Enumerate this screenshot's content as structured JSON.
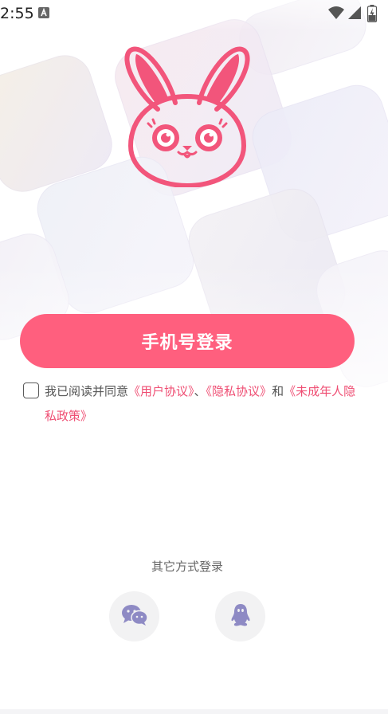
{
  "status_bar": {
    "time": "2:55"
  },
  "login": {
    "phone_button_label": "手机号登录"
  },
  "agreement": {
    "prefix": "我已阅读并同意",
    "user_agreement": "《用户协议》",
    "separator": "、",
    "privacy_agreement": "《隐私协议》",
    "conjunction": "和",
    "minor_privacy_policy": "《未成年人隐私政策》"
  },
  "other_login": {
    "label": "其它方式登录",
    "options": [
      {
        "icon": "wechat-icon"
      },
      {
        "icon": "qq-icon"
      }
    ]
  },
  "colors": {
    "accent": "#ff5f7e",
    "link": "#ef4e73",
    "social_icon": "#8e8ac4"
  }
}
